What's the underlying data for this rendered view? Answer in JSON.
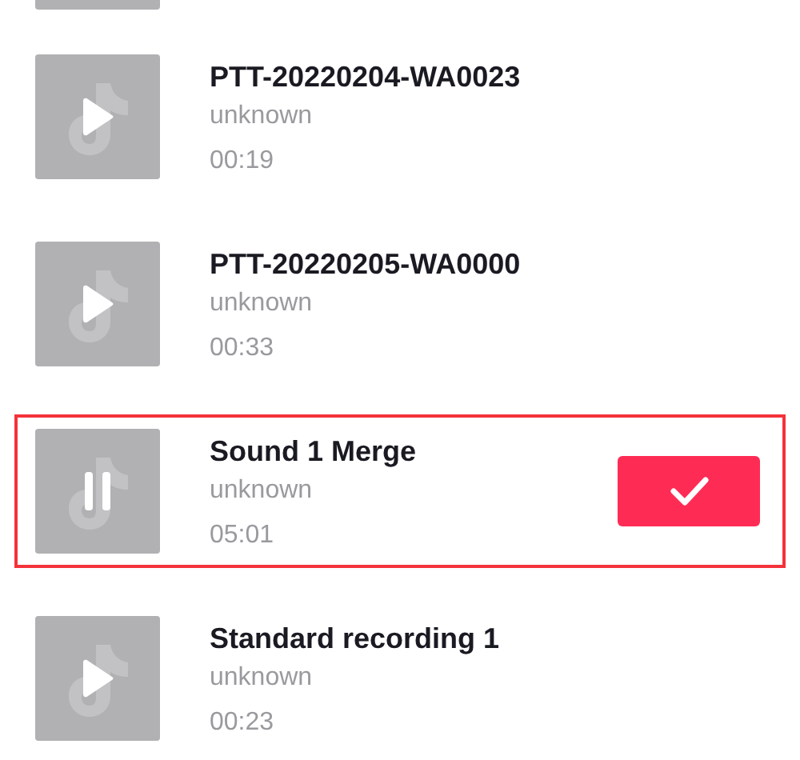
{
  "sounds": [
    {
      "title": "PTT-20220204-WA0023",
      "artist": "unknown",
      "duration": "00:19",
      "playing": false,
      "selected": false
    },
    {
      "title": "PTT-20220205-WA0000",
      "artist": "unknown",
      "duration": "00:33",
      "playing": false,
      "selected": false
    },
    {
      "title": "Sound 1 Merge",
      "artist": "unknown",
      "duration": "05:01",
      "playing": true,
      "selected": true
    },
    {
      "title": "Standard recording 1",
      "artist": "unknown",
      "duration": "00:23",
      "playing": false,
      "selected": false
    }
  ]
}
